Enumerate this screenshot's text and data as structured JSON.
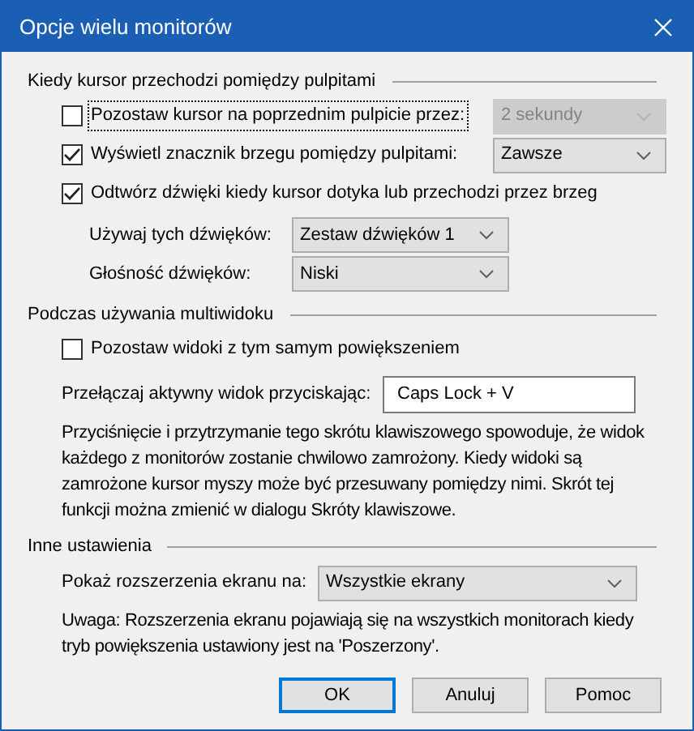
{
  "window": {
    "title": "Opcje wielu monitorów"
  },
  "sections": [
    {
      "title": "Kiedy kursor przechodzi pomiędzy pulpitami",
      "items": [
        {
          "kind": "checkbox",
          "label": "Pozostaw kursor na poprzednim pulpicie przez:",
          "checked": false,
          "focused": true,
          "select": {
            "value": "2 sekundy",
            "disabled": true
          }
        },
        {
          "kind": "checkbox",
          "label": "Wyświetl znacznik brzegu pomiędzy pulpitami:",
          "checked": true,
          "focused": false,
          "select": {
            "value": "Zawsze",
            "disabled": false
          }
        },
        {
          "kind": "checkbox",
          "label": "Odtwórz dźwięki kiedy kursor dotyka lub przechodzi przez brzeg",
          "checked": true,
          "focused": false,
          "children": [
            {
              "label": "Używaj tych dźwięków:",
              "value": "Zestaw dźwięków 1"
            },
            {
              "label": "Głośność dźwięków:",
              "value": "Niski"
            }
          ]
        }
      ]
    },
    {
      "title": "Podczas używania multiwidoku",
      "items": [
        {
          "kind": "checkbox",
          "label": "Pozostaw widoki z tym samym powiększeniem",
          "checked": false,
          "focused": false
        },
        {
          "kind": "hotkey",
          "label": "Przełączaj aktywny widok przyciskając:",
          "value": "Caps Lock + V"
        },
        {
          "kind": "note",
          "text": "Przyciśnięcie i przytrzymanie tego skrótu klawiszowego spowoduje, że widok każdego z monitorów zostanie chwilowo zamrożony. Kiedy widoki są zamrożone kursor myszy może być przesuwany pomiędzy nimi. Skrót tej funkcji można zmienić w dialogu Skróty klawiszowe."
        }
      ]
    },
    {
      "title": "Inne ustawienia",
      "items": [
        {
          "kind": "select",
          "label": "Pokaż rozszerzenia ekranu na:",
          "value": "Wszystkie ekrany"
        },
        {
          "kind": "note",
          "text": "Uwaga: Rozszerzenia ekranu pojawiają się na wszystkich monitorach kiedy tryb powiększenia ustawiony jest na 'Poszerzony'."
        }
      ]
    }
  ],
  "buttons": [
    {
      "label": "OK",
      "default": true
    },
    {
      "label": "Anuluj",
      "default": false
    },
    {
      "label": "Pomoc",
      "default": false
    }
  ]
}
